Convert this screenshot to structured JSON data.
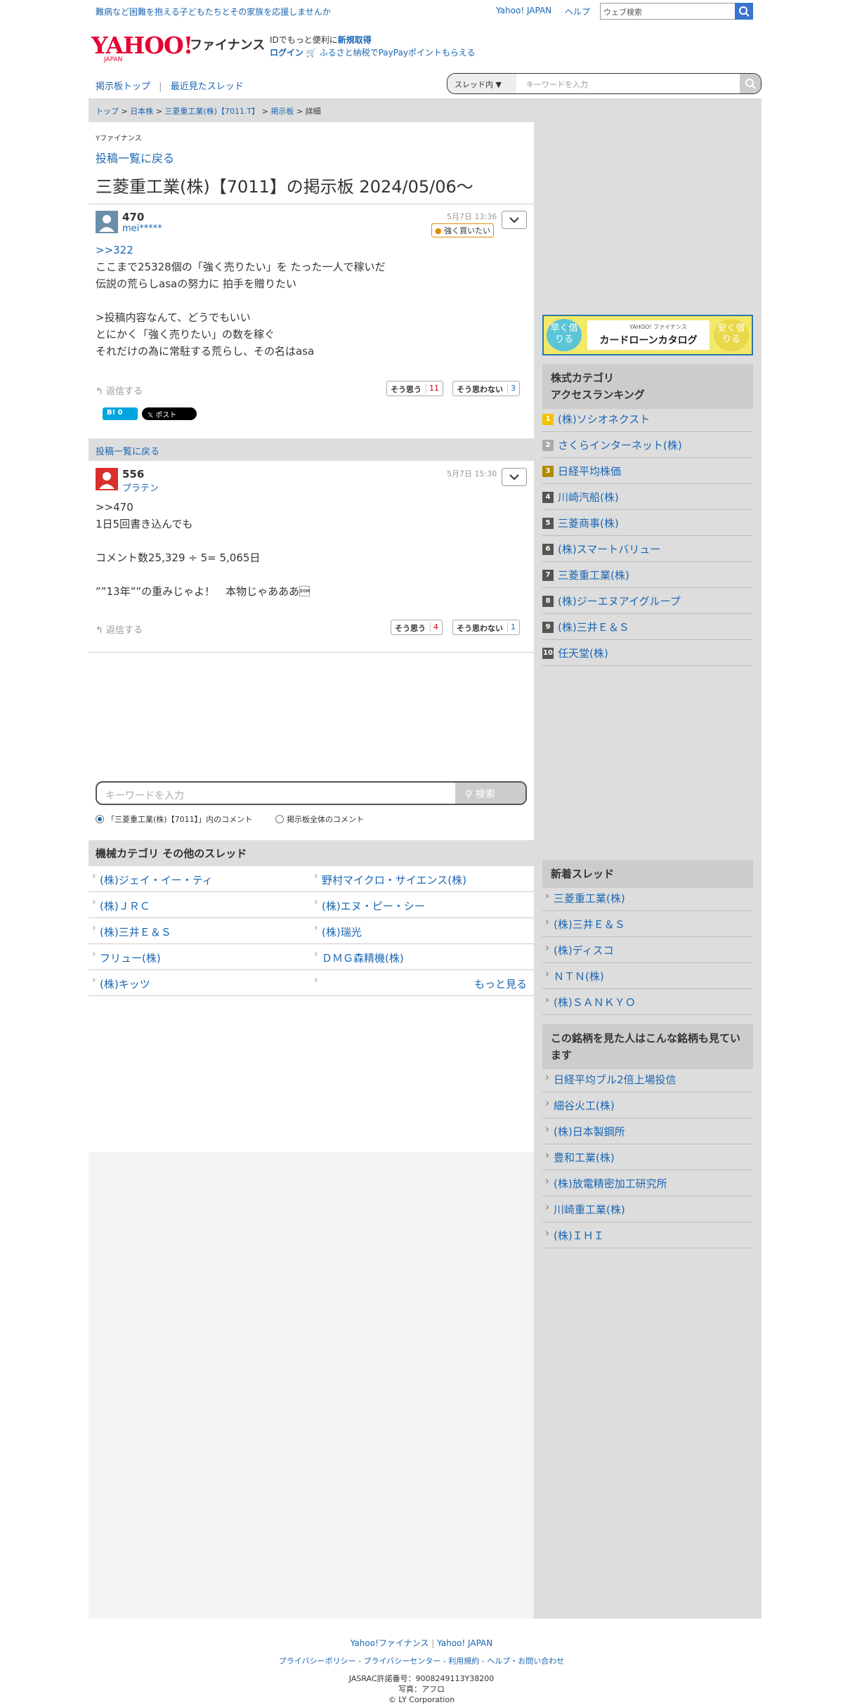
{
  "header": {
    "promo": "難病など困難を抱える子どもたちとその家族を応援しませんか",
    "yahoo_japan": "Yahoo! JAPAN",
    "help": "ヘルプ",
    "web_search_placeholder": "ウェブ検索",
    "logo": "YAHOO!",
    "logo_sub": "JAPAN",
    "finance": "ファイナンス",
    "id_text": "IDでもっと便利に",
    "signup": "新規取得",
    "login": "ログイン",
    "furusato": "ふるさと納税でPayPayポイントもらえる"
  },
  "boardnav": {
    "top": "掲示板トップ",
    "recent": "最近見たスレッド"
  },
  "thread_search": {
    "scope": "スレッド内",
    "placeholder": "キーワードを入力"
  },
  "breadcrumb": [
    "トップ",
    "日本株",
    "三菱重工業(株)【7011.T】",
    "掲示板",
    "詳細"
  ],
  "brand_small": "Yファイナンス",
  "back_link": "投稿一覧に戻る",
  "page_title": "三菱重工業(株)【7011】の掲示板 2024/05/06〜",
  "posts": [
    {
      "number": "470",
      "user": "mei*****",
      "date": "5月7日 13:36",
      "badge": "強く買いたい",
      "body": ">>322\nここまで25328個の「強く売りたい」を たった一人で稼いだ\n伝説の荒らしasaの努力に 拍手を贈りたい\n\n>投稿内容なんて、どうでもいい\nとにかく「強く売りたい」の数を稼ぐ\nそれだけの為に常駐する荒らし、その名はasa",
      "reply": "返信する",
      "agree": "そう思う",
      "agree_count": "11",
      "disagree": "そう思わない",
      "disagree_count": "3"
    },
    {
      "number": "556",
      "user": "プラテン",
      "date": "5月7日 15:30",
      "body": ">>470\n1日5回書き込んでも\n\nコメント数25,329 ÷ 5= 5,065日\n\n””13年””の重みじゃよ！　本物じゃあああ\u0001",
      "reply": "返信する",
      "agree": "そう思う",
      "agree_count": "4",
      "disagree": "そう思わない",
      "disagree_count": "1"
    }
  ],
  "share": {
    "hatena": "B! 0",
    "x": "𝕏 ポスト"
  },
  "comment_search": {
    "placeholder": "キーワードを入力",
    "button": "検索",
    "radio1": "「三菱重工業(株)【7011】」内のコメント",
    "radio2": "掲示板全体のコメント"
  },
  "other_threads": {
    "title": "機械カテゴリ その他のスレッド",
    "items": [
      "(株)ジェイ・イー・ティ",
      "野村マイクロ・サイエンス(株)",
      "(株)ＪＲＣ",
      "(株)エヌ・ピー・シー",
      "(株)三井Ｅ＆Ｓ",
      "(株)瑞光",
      "フリュー(株)",
      "ＤＭＧ森精機(株)",
      "(株)キッツ"
    ],
    "more": "もっと見る"
  },
  "ad": {
    "left": "早く借りる",
    "brand": "YAHOO! ファイナンス",
    "title": "カードローンカタログ",
    "right": "安く借りる"
  },
  "ranking": {
    "title": "株式カテゴリ\nアクセスランキング",
    "items": [
      "(株)ソシオネクスト",
      "さくらインターネット(株)",
      "日経平均株価",
      "川崎汽船(株)",
      "三菱商事(株)",
      "(株)スマートバリュー",
      "三菱重工業(株)",
      "(株)ジーエヌアイグループ",
      "(株)三井Ｅ＆Ｓ",
      "任天堂(株)"
    ],
    "ranks": [
      "1",
      "2",
      "3",
      "4",
      "5",
      "6",
      "7",
      "8",
      "9",
      "10"
    ]
  },
  "new_threads": {
    "title": "新着スレッド",
    "items": [
      "三菱重工業(株)",
      "(株)三井Ｅ＆Ｓ",
      "(株)ディスコ",
      "ＮＴＮ(株)",
      "(株)ＳＡＮＫＹＯ"
    ]
  },
  "also_viewed": {
    "title": "この銘柄を見た人はこんな銘柄も見ています",
    "items": [
      "日経平均ブル2倍上場投信",
      "細谷火工(株)",
      "(株)日本製鋼所",
      "豊和工業(株)",
      "(株)放電精密加工研究所",
      "川崎重工業(株)",
      "(株)ＩＨＩ"
    ]
  },
  "footer": {
    "links1": [
      "Yahoo!ファイナンス",
      "Yahoo! JAPAN"
    ],
    "links2": [
      "プライバシーポリシー",
      "プライバシーセンター",
      "利用規約",
      "ヘルプ・お問い合わせ"
    ],
    "jasrac": "JASRAC許諾番号：9008249113Y38200",
    "photo": "写真：アフロ",
    "copyright": "© LY Corporation"
  },
  "colors": {
    "accent": "#1a66b3",
    "brand_red": "#e60033",
    "side_bg": "#dddddd"
  }
}
